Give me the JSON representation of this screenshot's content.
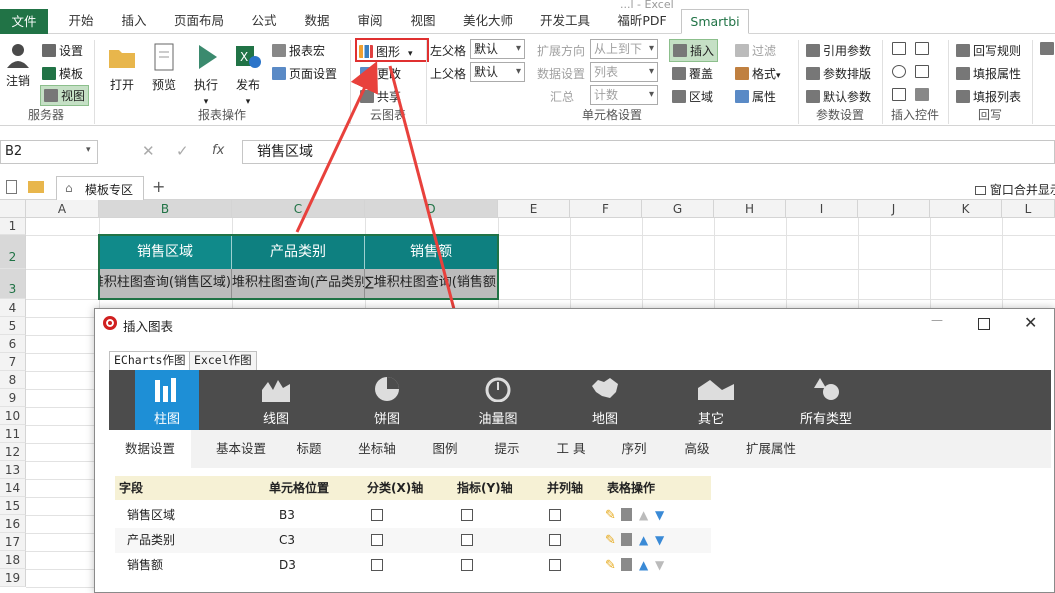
{
  "menu": {
    "tabs": [
      "文件",
      "开始",
      "插入",
      "页面布局",
      "公式",
      "数据",
      "审阅",
      "视图",
      "美化大师",
      "开发工具",
      "福昕PDF",
      "Smartbi"
    ],
    "title_fragment": "...l - Excel"
  },
  "ribbon": {
    "server": {
      "logout": "注销",
      "settings": "设置",
      "template": "模板",
      "view": "视图",
      "group": "服务器"
    },
    "report": {
      "open": "打开",
      "preview": "预览",
      "run": "执行",
      "publish": "发布",
      "macro": "报表宏",
      "page_setup": "页面设置",
      "group": "报表操作"
    },
    "cloud": {
      "chart": "图形",
      "update": "更改",
      "share": "共享",
      "group": "云图表"
    },
    "cell": {
      "left_parent": "左父格",
      "top_parent": "上父格",
      "left_value": "默认",
      "top_value": "默认",
      "expand_dir": "扩展方向",
      "expand_value": "从上到下",
      "data_setting": "数据设置",
      "data_value": "列表",
      "summary": "汇总",
      "summary_value": "计数",
      "insert": "插入",
      "overwrite": "覆盖",
      "area": "区域",
      "filter": "过滤",
      "format": "格式",
      "attr": "属性",
      "group": "单元格设置"
    },
    "param": {
      "ref": "引用参数",
      "layout": "参数排版",
      "default": "默认参数",
      "group": "参数设置"
    },
    "control": {
      "group": "插入控件"
    },
    "writeback": {
      "rule": "回写规则",
      "fill_attr": "填报属性",
      "fill_list": "填报列表",
      "group": "回写"
    }
  },
  "formula": {
    "cellref": "B2",
    "content": "销售区域",
    "fx": "fx"
  },
  "sheettabs": {
    "template_zone": "模板专区",
    "window_merge": "窗口合并显示"
  },
  "grid": {
    "columns": [
      "A",
      "B",
      "C",
      "D",
      "E",
      "F",
      "G",
      "H",
      "I",
      "J",
      "K",
      "L"
    ],
    "rows": [
      "1",
      "2",
      "3",
      "4",
      "5",
      "6",
      "7",
      "8",
      "9",
      "10",
      "11",
      "12",
      "13",
      "14",
      "15",
      "16",
      "17",
      "18",
      "19"
    ],
    "headers": [
      "销售区域",
      "产品类别",
      "销售额"
    ],
    "cells": [
      "堆积柱图查询(销售区域)",
      "堆积柱图查询(产品类别)",
      "∑堆积柱图查询(销售额)"
    ]
  },
  "dialog": {
    "title": "插入图表",
    "source_tabs": [
      "ECharts作图",
      "Excel作图"
    ],
    "chart_types": [
      "柱图",
      "线图",
      "饼图",
      "油量图",
      "地图",
      "其它",
      "所有类型"
    ],
    "sub_tabs": [
      "数据设置",
      "基本设置",
      "标题",
      "坐标轴",
      "图例",
      "提示",
      "工 具",
      "序列",
      "高级",
      "扩展属性"
    ],
    "field_headers": [
      "字段",
      "单元格位置",
      "分类(X)轴",
      "指标(Y)轴",
      "并列轴",
      "表格操作"
    ],
    "fields": [
      {
        "name": "销售区域",
        "cell": "B3"
      },
      {
        "name": "产品类别",
        "cell": "C3"
      },
      {
        "name": "销售额",
        "cell": "D3"
      }
    ]
  }
}
